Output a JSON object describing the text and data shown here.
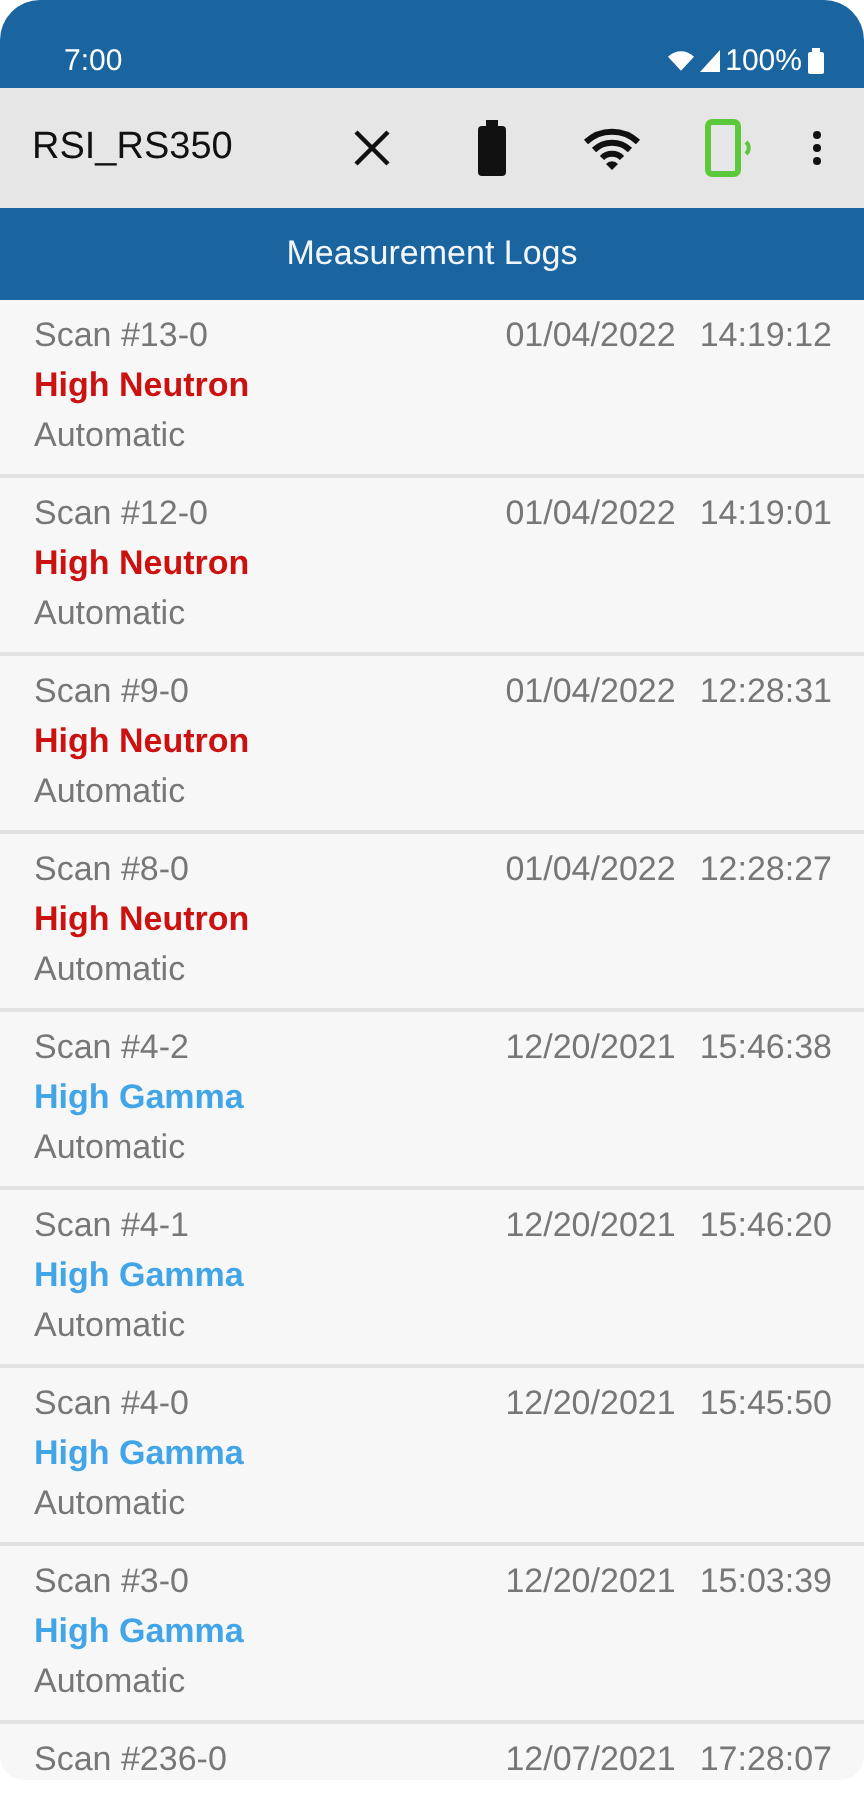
{
  "status_bar": {
    "time": "7:00",
    "battery": "100%"
  },
  "toolbar": {
    "device": "RSI_RS350"
  },
  "header": {
    "title": "Measurement Logs"
  },
  "logs": [
    {
      "name": "Scan #13-0",
      "date": "01/04/2022",
      "time": "14:19:12",
      "alarm": "High Neutron",
      "color": "#cc1111",
      "mode": "Automatic"
    },
    {
      "name": "Scan #12-0",
      "date": "01/04/2022",
      "time": "14:19:01",
      "alarm": "High Neutron",
      "color": "#cc1111",
      "mode": "Automatic"
    },
    {
      "name": "Scan #9-0",
      "date": "01/04/2022",
      "time": "12:28:31",
      "alarm": "High Neutron",
      "color": "#cc1111",
      "mode": "Automatic"
    },
    {
      "name": "Scan #8-0",
      "date": "01/04/2022",
      "time": "12:28:27",
      "alarm": "High Neutron",
      "color": "#cc1111",
      "mode": "Automatic"
    },
    {
      "name": "Scan #4-2",
      "date": "12/20/2021",
      "time": "15:46:38",
      "alarm": "High Gamma",
      "color": "#42a5e8",
      "mode": "Automatic"
    },
    {
      "name": "Scan #4-1",
      "date": "12/20/2021",
      "time": "15:46:20",
      "alarm": "High Gamma",
      "color": "#42a5e8",
      "mode": "Automatic"
    },
    {
      "name": "Scan #4-0",
      "date": "12/20/2021",
      "time": "15:45:50",
      "alarm": "High Gamma",
      "color": "#42a5e8",
      "mode": "Automatic"
    },
    {
      "name": "Scan #3-0",
      "date": "12/20/2021",
      "time": "15:03:39",
      "alarm": "High Gamma",
      "color": "#42a5e8",
      "mode": "Automatic"
    },
    {
      "name": "Scan #236-0",
      "date": "12/07/2021",
      "time": "17:28:07"
    }
  ]
}
